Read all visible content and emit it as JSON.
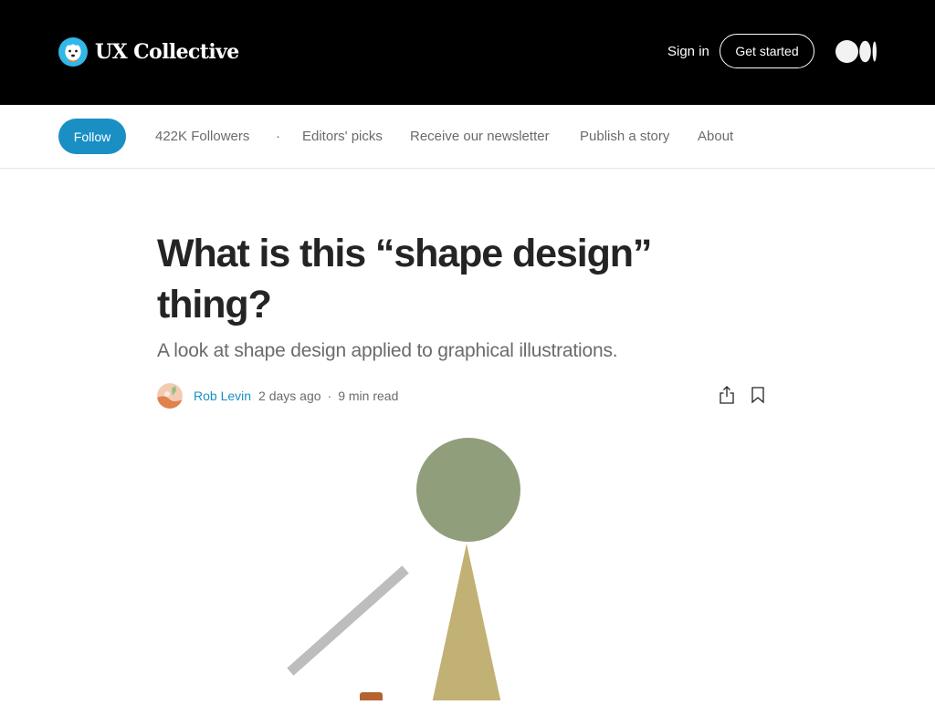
{
  "header": {
    "brand_name": "UX Collective",
    "signin_label": "Sign in",
    "get_started_label": "Get started",
    "colors": {
      "background": "#000000",
      "text": "#ffffff"
    }
  },
  "publication_nav": {
    "follow_label": "Follow",
    "followers_label": "422K Followers",
    "separator": "·",
    "links": [
      "Editors' picks",
      "Receive our newsletter",
      "Publish a story",
      "About"
    ],
    "accent_color": "#1a8fc4"
  },
  "article": {
    "title": "What is this “shape design” thing?",
    "subtitle": "A look at shape design applied to graphical illustrations.",
    "author": "Rob Levin",
    "published": "2 days ago",
    "separator": "·",
    "read_time": "9 min read",
    "actions": [
      "share-icon",
      "bookmark-icon"
    ]
  },
  "hero_image": {
    "colors": {
      "circle": "#919e7b",
      "triangle": "#c2b174",
      "stick": "#bdbdbd",
      "small_shape": "#b4622f"
    }
  }
}
